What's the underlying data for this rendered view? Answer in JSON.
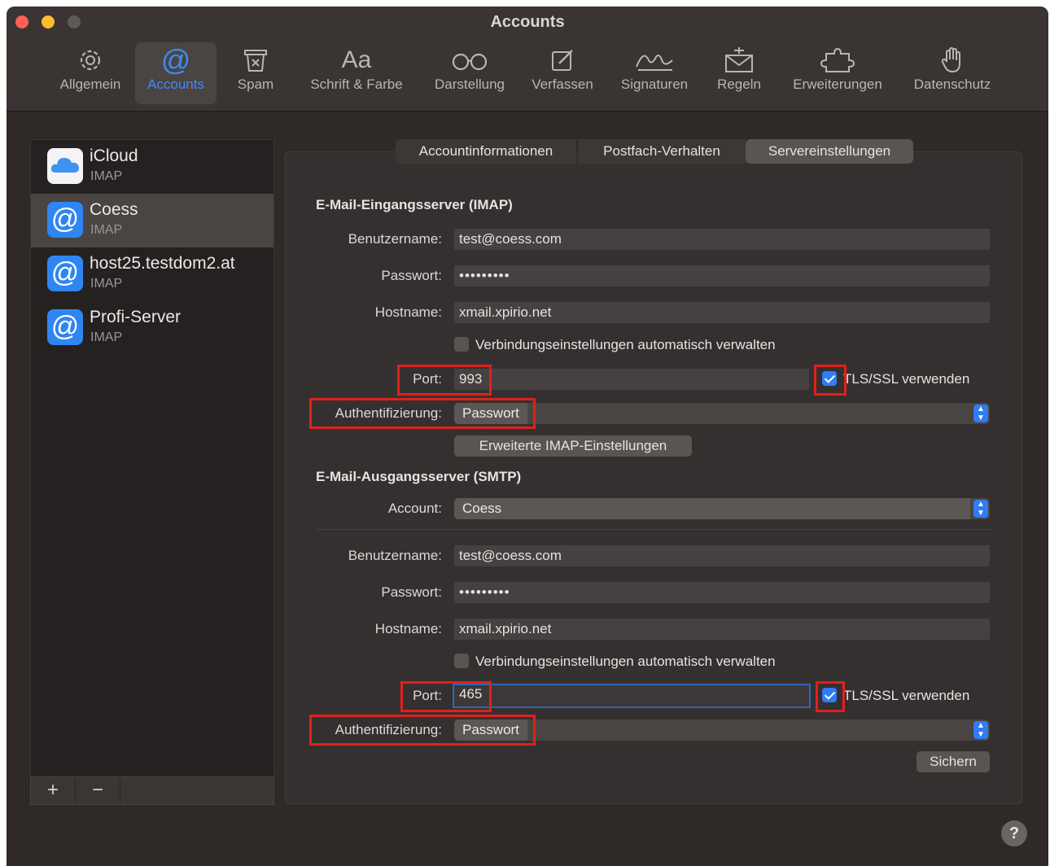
{
  "window": {
    "title": "Accounts",
    "traffic_lights": [
      "#ff5f57",
      "#febc2e",
      "#5e5a59"
    ]
  },
  "toolbar": {
    "items": [
      {
        "label": "Allgemein",
        "icon": "gear-icon"
      },
      {
        "label": "Accounts",
        "icon": "at-icon",
        "selected": true
      },
      {
        "label": "Spam",
        "icon": "trash-x-icon"
      },
      {
        "label": "Schrift & Farbe",
        "icon": "font-icon",
        "glyph": "Aa"
      },
      {
        "label": "Darstellung",
        "icon": "glasses-icon"
      },
      {
        "label": "Verfassen",
        "icon": "compose-icon"
      },
      {
        "label": "Signaturen",
        "icon": "signature-icon"
      },
      {
        "label": "Regeln",
        "icon": "rules-envelope-icon"
      },
      {
        "label": "Erweiterungen",
        "icon": "puzzle-icon"
      },
      {
        "label": "Datenschutz",
        "icon": "hand-icon"
      }
    ]
  },
  "sidebar": {
    "accounts": [
      {
        "name": "iCloud",
        "type": "IMAP",
        "icon": "icloud-icon"
      },
      {
        "name": "Coess",
        "type": "IMAP",
        "icon": "at-account-icon",
        "selected": true
      },
      {
        "name": "host25.testdom2.at",
        "type": "IMAP",
        "icon": "at-account-icon"
      },
      {
        "name": "Profi-Server",
        "type": "IMAP",
        "icon": "at-account-icon"
      }
    ],
    "add_label": "+",
    "remove_label": "−"
  },
  "tabs": [
    {
      "label": "Accountinformationen"
    },
    {
      "label": "Postfach-Verhalten"
    },
    {
      "label": "Servereinstellungen",
      "selected": true
    }
  ],
  "imap": {
    "section_title": "E-Mail-Eingangsserver (IMAP)",
    "username_label": "Benutzername:",
    "username": "test@coess.com",
    "password_label": "Passwort:",
    "password": "•••••••••",
    "hostname_label": "Hostname:",
    "hostname": "xmail.xpirio.net",
    "auto_manage_label": "Verbindungseinstellungen automatisch verwalten",
    "port_label": "Port:",
    "port": "993",
    "tls_label": "TLS/SSL verwenden",
    "auth_label": "Authentifizierung:",
    "auth_value": "Passwort",
    "advanced_button": "Erweiterte IMAP-Einstellungen"
  },
  "smtp": {
    "section_title": "E-Mail-Ausgangsserver (SMTP)",
    "account_label": "Account:",
    "account_value": "Coess",
    "username_label": "Benutzername:",
    "username": "test@coess.com",
    "password_label": "Passwort:",
    "password": "•••••••••",
    "hostname_label": "Hostname:",
    "hostname": "xmail.xpirio.net",
    "auto_manage_label": "Verbindungseinstellungen automatisch verwalten",
    "port_label": "Port:",
    "port": "465",
    "tls_label": "TLS/SSL verwenden",
    "auth_label": "Authentifizierung:",
    "auth_value": "Passwort"
  },
  "save_button": "Sichern",
  "help_label": "?",
  "colors": {
    "accent": "#2f7cf6",
    "highlight": "#e0201b"
  }
}
